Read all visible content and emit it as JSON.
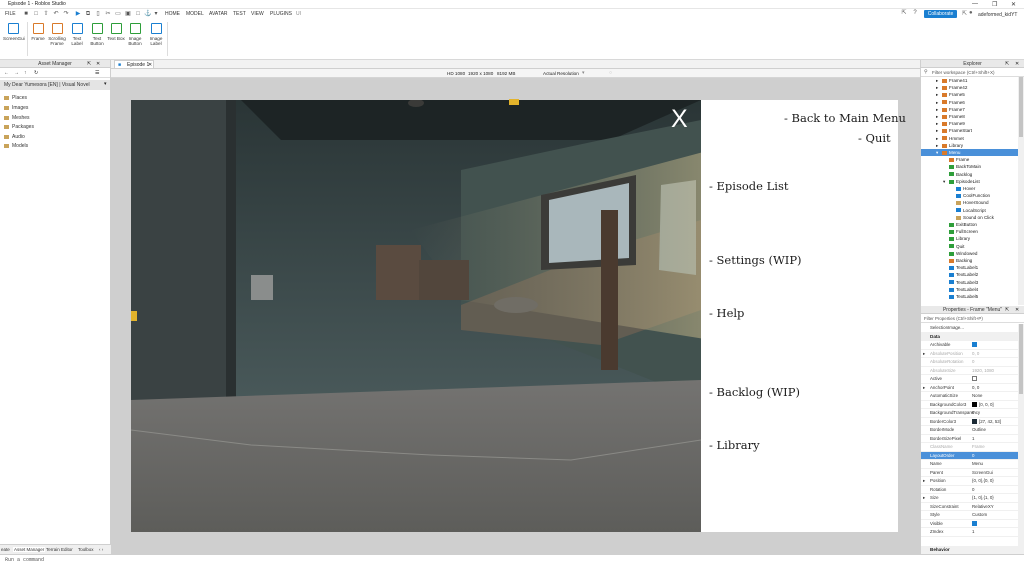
{
  "window": {
    "title": "Episode 1 - Roblox Studio"
  },
  "menubar": {
    "file": "FILE",
    "tabs": [
      "HOME",
      "MODEL",
      "AVATAR",
      "TEST",
      "VIEW",
      "PLUGINS",
      "UI"
    ],
    "collaborate": "Collaborate",
    "user": "adeformed_kidYT"
  },
  "ribbon": {
    "buttons": [
      {
        "label": "ScreenGui",
        "icon": "screengui-icon"
      },
      {
        "label": "Frame",
        "icon": "frame-icon"
      },
      {
        "label": "Scrolling Frame",
        "icon": "scrolling-frame-icon"
      },
      {
        "label": "Text Label",
        "icon": "text-label-icon"
      },
      {
        "label": "Text Button",
        "icon": "text-button-icon"
      },
      {
        "label": "Text Box",
        "icon": "text-box-icon"
      },
      {
        "label": "Image Button",
        "icon": "image-button-icon"
      },
      {
        "label": "Image Label",
        "icon": "image-label-icon"
      }
    ]
  },
  "asset_manager": {
    "title": "Asset Manager",
    "game": "My Dear Yumesora [EN] | Visual Novel",
    "items": [
      "Places",
      "Images",
      "Meshes",
      "Packages",
      "Audio",
      "Models"
    ]
  },
  "bottom_tabs": [
    "eate",
    "Asset Manager",
    "Terrain Editor",
    "Toolbox"
  ],
  "doc_tab": "Episode 1",
  "device_bar": {
    "device": "HD 1080",
    "resolution": "1920 x 1080",
    "memory": "8192 MB",
    "view": "Actual Resolution"
  },
  "game_menu": {
    "close": "X",
    "back": "- Back to Main Menu",
    "quit": "- Quit",
    "episodes": "- Episode List",
    "settings": "- Settings (WIP)",
    "help": "- Help",
    "backlog": "- Backlog (WIP)",
    "library": "- Library"
  },
  "explorer": {
    "title": "Explorer",
    "filter": "Filter workspace (Ctrl+Shift+X)",
    "rows": [
      {
        "label": "Frame41"
      },
      {
        "label": "Frame42"
      },
      {
        "label": "Frame5"
      },
      {
        "label": "Frame6"
      },
      {
        "label": "Frame7"
      },
      {
        "label": "Frame8"
      },
      {
        "label": "Frame9"
      },
      {
        "label": "FrameStart"
      },
      {
        "label": "Hmmet"
      },
      {
        "label": "Library"
      },
      {
        "label": "Menu"
      },
      {
        "label": "Frame"
      },
      {
        "label": "BackToMain"
      },
      {
        "label": "Backlog"
      },
      {
        "label": "EpisodeList"
      },
      {
        "label": "Hover"
      },
      {
        "label": "CoolFunction"
      },
      {
        "label": "HoverSound"
      },
      {
        "label": "LocalScript"
      },
      {
        "label": "Sound on Click"
      },
      {
        "label": "ExitButton"
      },
      {
        "label": "FullScreen"
      },
      {
        "label": "Library"
      },
      {
        "label": "Quit"
      },
      {
        "label": "Windowed"
      },
      {
        "label": "Backing"
      },
      {
        "label": "TextLabel1"
      },
      {
        "label": "TextLabel2"
      },
      {
        "label": "TextLabel3"
      },
      {
        "label": "TextLabel4"
      },
      {
        "label": "TextLabel5"
      }
    ]
  },
  "properties": {
    "title": "Properties - Frame \"Menu\"",
    "filter": "Filter Properties (Ctrl+Shift+P)",
    "selection": "SelectionImage...",
    "section_data": "Data",
    "section_behavior": "Behavior",
    "rows": [
      {
        "name": "Archivable",
        "value": ""
      },
      {
        "name": "AbsolutePosition",
        "value": "0, 0"
      },
      {
        "name": "AbsoluteRotation",
        "value": "0"
      },
      {
        "name": "AbsoluteSize",
        "value": "1920, 1080"
      },
      {
        "name": "Active",
        "value": ""
      },
      {
        "name": "AnchorPoint",
        "value": "0, 0"
      },
      {
        "name": "AutomaticSize",
        "value": "None"
      },
      {
        "name": "BackgroundColor3",
        "value": "[0, 0, 0]"
      },
      {
        "name": "BackgroundTransparency",
        "value": "0"
      },
      {
        "name": "BorderColor3",
        "value": "[27, 42, 53]"
      },
      {
        "name": "BorderMode",
        "value": "Outline"
      },
      {
        "name": "BorderSizePixel",
        "value": "1"
      },
      {
        "name": "ClassName",
        "value": "Frame"
      },
      {
        "name": "LayoutOrder",
        "value": "0"
      },
      {
        "name": "Name",
        "value": "Menu"
      },
      {
        "name": "Parent",
        "value": "ScreenGui"
      },
      {
        "name": "Position",
        "value": "{0, 0},{0, 0}"
      },
      {
        "name": "Rotation",
        "value": "0"
      },
      {
        "name": "Size",
        "value": "{1, 0},{1, 0}"
      },
      {
        "name": "SizeConstraint",
        "value": "RelativeXY"
      },
      {
        "name": "Style",
        "value": "Custom"
      },
      {
        "name": "Visible",
        "value": ""
      },
      {
        "name": "ZIndex",
        "value": "1"
      }
    ]
  },
  "command_bar": {
    "placeholder": "Run a command"
  }
}
